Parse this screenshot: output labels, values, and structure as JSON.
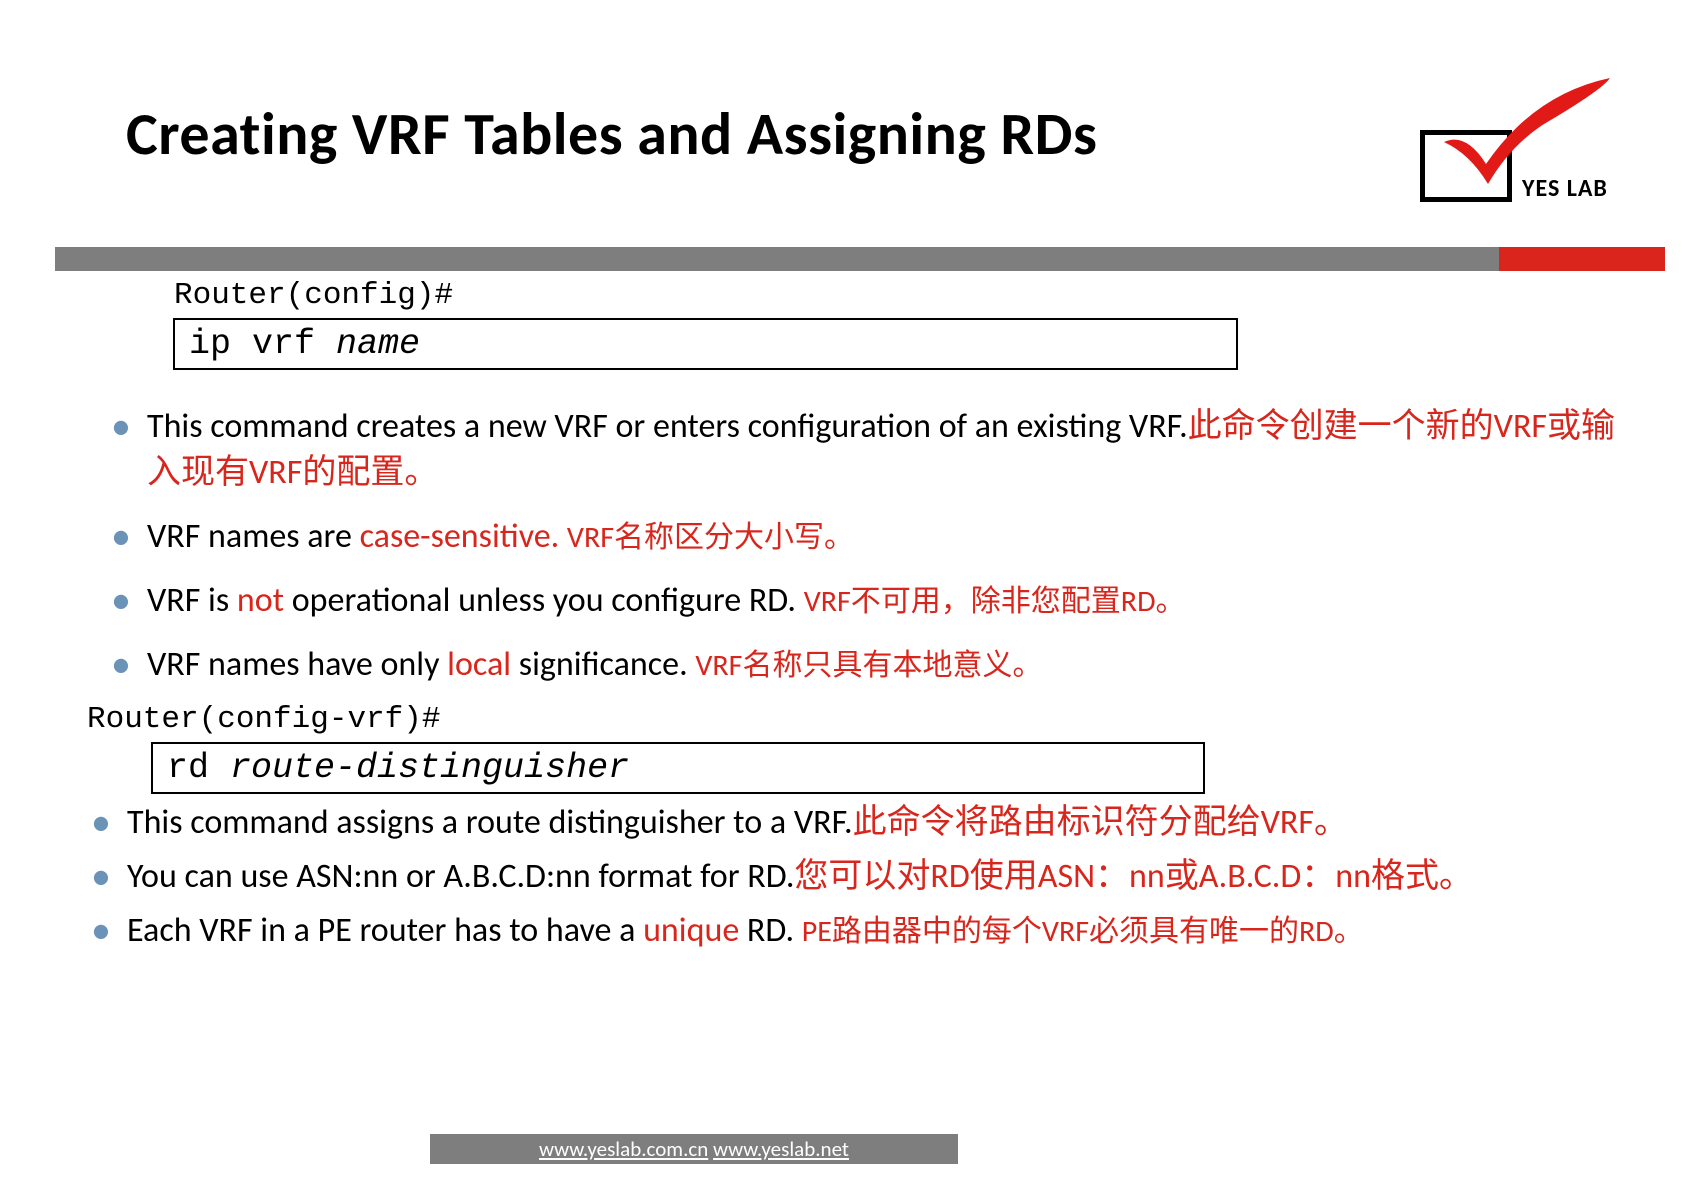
{
  "title": "Creating VRF Tables and Assigning RDs",
  "logo": {
    "text": "YES LAB"
  },
  "prompt1": "Router(config)#",
  "code1": {
    "cmd": "ip vrf ",
    "arg": "name"
  },
  "prompt2": "Router(config-vrf)#",
  "code2": {
    "cmd": "rd ",
    "arg": "route-distinguisher"
  },
  "bullets1": {
    "b1": {
      "en": "This command creates a new VRF or enters configuration of an  existing VRF.",
      "zh": "此命令创建一个新的VRF或输入现有VRF的配置。"
    },
    "b2": {
      "en_a": "VRF names are ",
      "red": "case-sensitive. ",
      "zh": "VRF名称区分大小写。"
    },
    "b3": {
      "en_a": "VRF is ",
      "red": "not",
      "en_b": " operational unless you configure RD. ",
      "zh": "VRF不可用，除非您配置RD。"
    },
    "b4": {
      "en_a": "VRF names have only ",
      "red": "local",
      "en_b": " significance. ",
      "zh": "VRF名称只具有本地意义。"
    }
  },
  "bullets2": {
    "b1": {
      "en": "This command assigns a route distinguisher to a VRF.",
      "zh": "此命令将路由标识符分配给VRF。"
    },
    "b2": {
      "en": "You can use ASN:nn or A.B.C.D:nn format for RD.",
      "zh": "您可以对RD使用ASN：nn或A.B.C.D：nn格式。"
    },
    "b3": {
      "en_a": "Each VRF in a PE router has to have a ",
      "red": "unique ",
      "en_b": "RD. ",
      "zh": "PE路由器中的每个VRF必须具有唯一的RD。"
    }
  },
  "footer": {
    "link1": "www.yeslab.com.cn",
    "sep": "   ",
    "link2": "www.yeslab.net"
  }
}
